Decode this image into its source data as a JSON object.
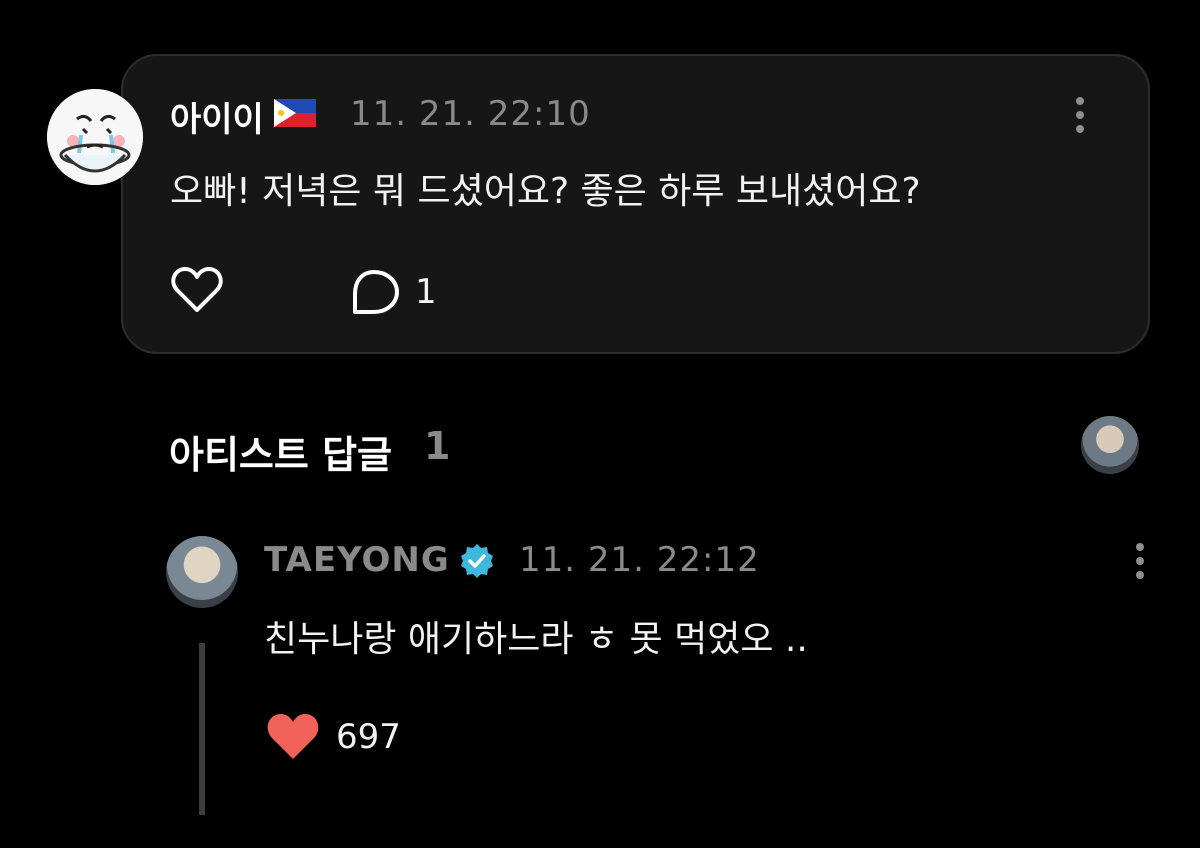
{
  "comment": {
    "author": "아이이",
    "flag_icon": "philippines-flag-icon",
    "timestamp": "11. 21. 22:10",
    "text": "오빠! 저녁은 뭐 드셨어요? 좋은 하루 보내셨어요?",
    "reply_count": "1"
  },
  "artist_replies": {
    "title": "아티스트 답글",
    "count": "1"
  },
  "reply": {
    "author": "TAEYONG",
    "timestamp": "11. 21. 22:12",
    "text": "친누나랑 애기하느라 ㅎ 못 먹었오 ..",
    "like_count": "697"
  },
  "colors": {
    "background": "#000000",
    "card": "#161616",
    "muted_text": "#8a8a8a",
    "like_red": "#f0625a",
    "verified_blue": "#3db9dd"
  }
}
